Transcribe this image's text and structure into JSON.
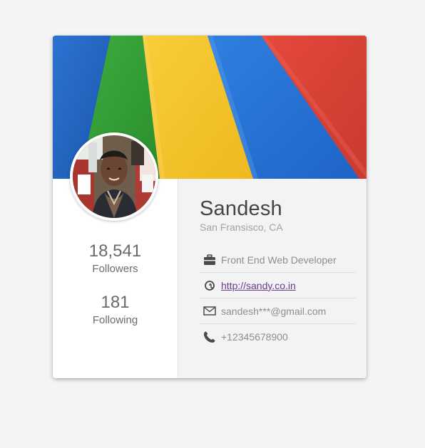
{
  "profile": {
    "name": "Sandesh",
    "location": "San Fransisco, CA"
  },
  "stats": {
    "followers": {
      "value": "18,541",
      "label": "Followers"
    },
    "following": {
      "value": "181",
      "label": "Following"
    }
  },
  "details": {
    "job": "Front End Web Developer",
    "website": "http://sandy.co.in",
    "email": "sandesh***@gmail.com",
    "phone": "+12345678900"
  },
  "icons": {
    "job": "briefcase-icon",
    "website": "at-sign-icon",
    "email": "envelope-icon",
    "phone": "phone-icon"
  },
  "colors": {
    "banner_blue": "#1f5fc0",
    "banner_green": "#2f9d35",
    "banner_yellow": "#f3c225",
    "banner_red": "#d84036",
    "link": "#6a3c8c"
  }
}
